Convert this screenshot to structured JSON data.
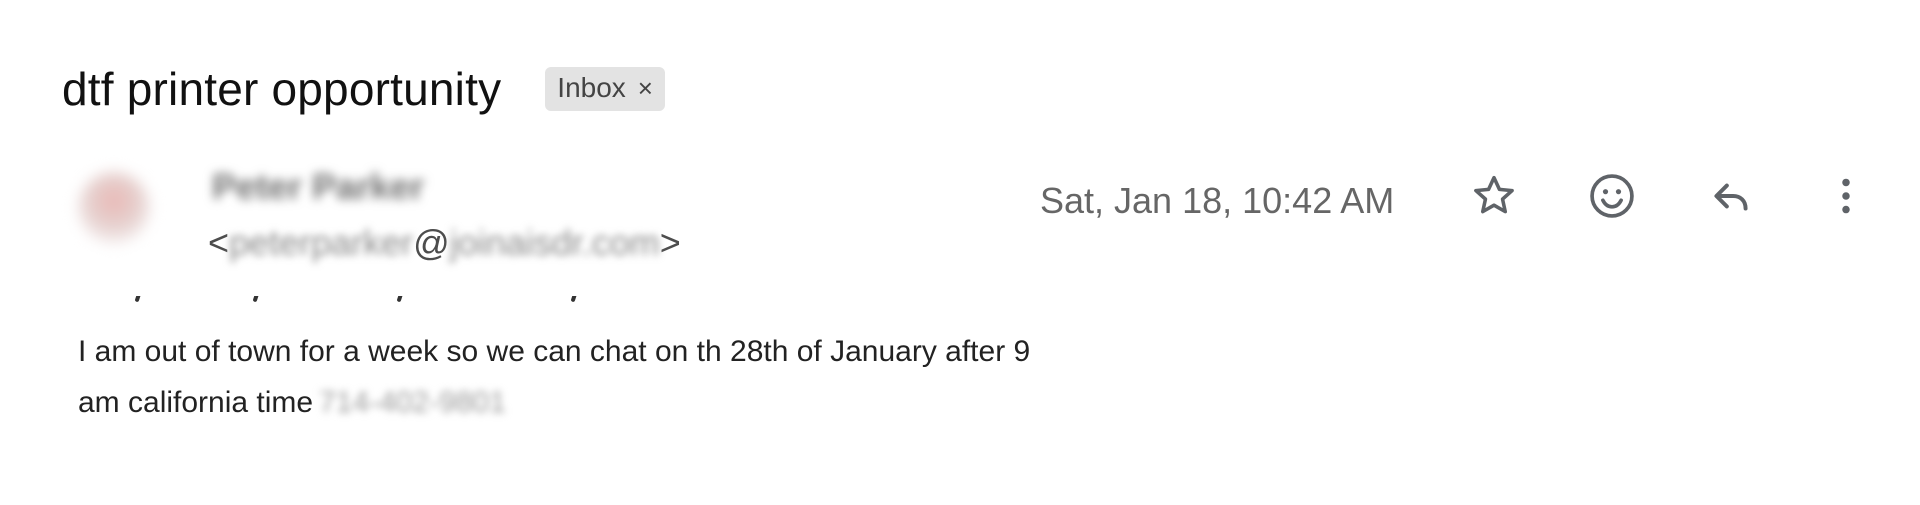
{
  "subject": "dtf printer opportunity",
  "label": {
    "text": "Inbox",
    "remove_symbol": "×"
  },
  "sender": {
    "name": "Peter Parker",
    "email_open": "<",
    "email_user": "peterparker",
    "email_at": "@",
    "email_domain": "joinaisdr.com",
    "email_close": ">"
  },
  "date": "Sat, Jan 18, 10:42 AM",
  "actions": {
    "star_icon": "star-icon",
    "emoji_icon": "smiley-icon",
    "reply_icon": "reply-icon",
    "more_icon": "more-vert-icon"
  },
  "body": {
    "line1": "I am out of town for a week so we can chat on th 28th of January after 9",
    "line2": "am california time",
    "phone": "714-402-9801"
  }
}
